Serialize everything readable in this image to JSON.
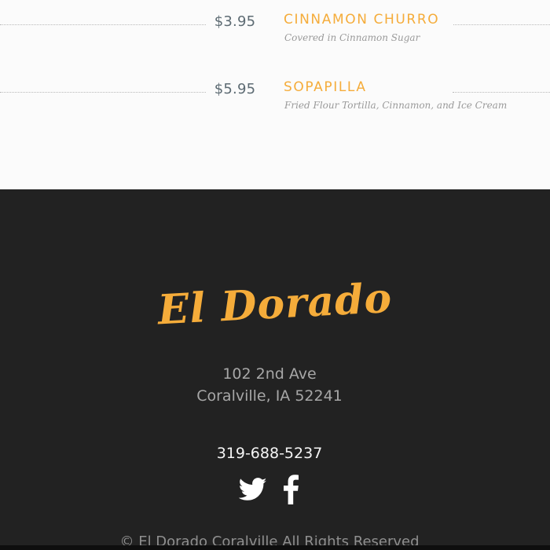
{
  "menu": {
    "items": [
      {
        "price": "$3.95",
        "name": "CINNAMON CHURRO",
        "description": "Covered in Cinnamon Sugar"
      },
      {
        "price": "$5.95",
        "name": "SOPAPILLA",
        "description": "Fried Flour Tortilla, Cinnamon, and Ice Cream"
      }
    ]
  },
  "footer": {
    "brand": "El Dorado",
    "address": [
      "102 2nd Ave",
      "Coralville, IA 52241"
    ],
    "phone": "319-688-5237",
    "social": [
      {
        "icon": "twitter-icon"
      },
      {
        "icon": "facebook-icon"
      }
    ],
    "copyright": "© El Dorado Coralville All Rights Reserved"
  },
  "colors": {
    "accent": "#f5ac3a",
    "footer_background": "#222222",
    "page_background": "#fbfbfb"
  }
}
